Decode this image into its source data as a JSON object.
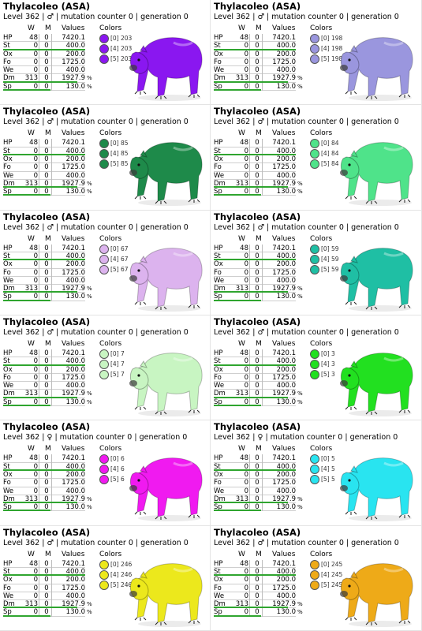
{
  "stat_headers": {
    "w": "W",
    "m": "M",
    "values": "Values",
    "colors": "Colors"
  },
  "cards": [
    {
      "title": "Thylacoleo (ASA)",
      "info": "Level 362 | ♂ | mutation counter 0 | generation 0",
      "accent": "#8a17f0",
      "stats": [
        {
          "label": "HP",
          "w": "48",
          "m": "0",
          "value": "7420.1",
          "unit": ""
        },
        {
          "label": "St",
          "w": "0",
          "m": "0",
          "value": "400.0",
          "unit": ""
        },
        {
          "label": "Ox",
          "w": "0",
          "m": "0",
          "value": "200.0",
          "unit": ""
        },
        {
          "label": "Fo",
          "w": "0",
          "m": "0",
          "value": "1725.0",
          "unit": ""
        },
        {
          "label": "We",
          "w": "0",
          "m": "0",
          "value": "400.0",
          "unit": ""
        },
        {
          "label": "Dm",
          "w": "313",
          "m": "0",
          "value": "1927.9",
          "unit": "%"
        },
        {
          "label": "Sp",
          "w": "0",
          "m": "0",
          "value": "130.0",
          "unit": "%"
        }
      ],
      "colors": [
        {
          "label": "[0] 203",
          "hex": "#8a17f0"
        },
        {
          "label": "[4] 203",
          "hex": "#8a17f0"
        },
        {
          "label": "[5] 203",
          "hex": "#8a17f0"
        }
      ]
    },
    {
      "title": "Thylacoleo (ASA)",
      "info": "Level 362 | ♂ | mutation counter 0 | generation 0",
      "accent": "#9a96de",
      "stats": [
        {
          "label": "HP",
          "w": "48",
          "m": "0",
          "value": "7420.1",
          "unit": ""
        },
        {
          "label": "St",
          "w": "0",
          "m": "0",
          "value": "400.0",
          "unit": ""
        },
        {
          "label": "Ox",
          "w": "0",
          "m": "0",
          "value": "200.0",
          "unit": ""
        },
        {
          "label": "Fo",
          "w": "0",
          "m": "0",
          "value": "1725.0",
          "unit": ""
        },
        {
          "label": "We",
          "w": "0",
          "m": "0",
          "value": "400.0",
          "unit": ""
        },
        {
          "label": "Dm",
          "w": "313",
          "m": "0",
          "value": "1927.9",
          "unit": "%"
        },
        {
          "label": "Sp",
          "w": "0",
          "m": "0",
          "value": "130.0",
          "unit": "%"
        }
      ],
      "colors": [
        {
          "label": "[0] 198",
          "hex": "#9a96de"
        },
        {
          "label": "[4] 198",
          "hex": "#9a96de"
        },
        {
          "label": "[5] 198",
          "hex": "#9a96de"
        }
      ]
    },
    {
      "title": "Thylacoleo (ASA)",
      "info": "Level 362 | ♂ | mutation counter 0 | generation 0",
      "accent": "#1e8a4a",
      "stats": [
        {
          "label": "HP",
          "w": "48",
          "m": "0",
          "value": "7420.1",
          "unit": ""
        },
        {
          "label": "St",
          "w": "0",
          "m": "0",
          "value": "400.0",
          "unit": ""
        },
        {
          "label": "Ox",
          "w": "0",
          "m": "0",
          "value": "200.0",
          "unit": ""
        },
        {
          "label": "Fo",
          "w": "0",
          "m": "0",
          "value": "1725.0",
          "unit": ""
        },
        {
          "label": "We",
          "w": "0",
          "m": "0",
          "value": "400.0",
          "unit": ""
        },
        {
          "label": "Dm",
          "w": "313",
          "m": "0",
          "value": "1927.9",
          "unit": "%"
        },
        {
          "label": "Sp",
          "w": "0",
          "m": "0",
          "value": "130.0",
          "unit": "%"
        }
      ],
      "colors": [
        {
          "label": "[0] 85",
          "hex": "#1e8a4a"
        },
        {
          "label": "[4] 85",
          "hex": "#1e8a4a"
        },
        {
          "label": "[5] 85",
          "hex": "#1e8a4a"
        }
      ]
    },
    {
      "title": "Thylacoleo (ASA)",
      "info": "Level 362 | ♂ | mutation counter 0 | generation 0",
      "accent": "#4fe38a",
      "stats": [
        {
          "label": "HP",
          "w": "48",
          "m": "0",
          "value": "7420.1",
          "unit": ""
        },
        {
          "label": "St",
          "w": "0",
          "m": "0",
          "value": "400.0",
          "unit": ""
        },
        {
          "label": "Ox",
          "w": "0",
          "m": "0",
          "value": "200.0",
          "unit": ""
        },
        {
          "label": "Fo",
          "w": "0",
          "m": "0",
          "value": "1725.0",
          "unit": ""
        },
        {
          "label": "We",
          "w": "0",
          "m": "0",
          "value": "400.0",
          "unit": ""
        },
        {
          "label": "Dm",
          "w": "313",
          "m": "0",
          "value": "1927.9",
          "unit": "%"
        },
        {
          "label": "Sp",
          "w": "0",
          "m": "0",
          "value": "130.0",
          "unit": "%"
        }
      ],
      "colors": [
        {
          "label": "[0] 84",
          "hex": "#4fe38a"
        },
        {
          "label": "[4] 84",
          "hex": "#4fe38a"
        },
        {
          "label": "[5] 84",
          "hex": "#4fe38a"
        }
      ]
    },
    {
      "title": "Thylacoleo (ASA)",
      "info": "Level 362 | ♂ | mutation counter 0 | generation 0",
      "accent": "#dcb3ee",
      "stats": [
        {
          "label": "HP",
          "w": "48",
          "m": "0",
          "value": "7420.1",
          "unit": ""
        },
        {
          "label": "St",
          "w": "0",
          "m": "0",
          "value": "400.0",
          "unit": ""
        },
        {
          "label": "Ox",
          "w": "0",
          "m": "0",
          "value": "200.0",
          "unit": ""
        },
        {
          "label": "Fo",
          "w": "0",
          "m": "0",
          "value": "1725.0",
          "unit": ""
        },
        {
          "label": "We",
          "w": "0",
          "m": "0",
          "value": "400.0",
          "unit": ""
        },
        {
          "label": "Dm",
          "w": "313",
          "m": "0",
          "value": "1927.9",
          "unit": "%"
        },
        {
          "label": "Sp",
          "w": "0",
          "m": "0",
          "value": "130.0",
          "unit": "%"
        }
      ],
      "colors": [
        {
          "label": "[0] 67",
          "hex": "#dcb3ee"
        },
        {
          "label": "[4] 67",
          "hex": "#dcb3ee"
        },
        {
          "label": "[5] 67",
          "hex": "#dcb3ee"
        }
      ]
    },
    {
      "title": "Thylacoleo (ASA)",
      "info": "Level 362 | ♂ | mutation counter 0 | generation 0",
      "accent": "#1fbfa4",
      "stats": [
        {
          "label": "HP",
          "w": "48",
          "m": "0",
          "value": "7420.1",
          "unit": ""
        },
        {
          "label": "St",
          "w": "0",
          "m": "0",
          "value": "400.0",
          "unit": ""
        },
        {
          "label": "Ox",
          "w": "0",
          "m": "0",
          "value": "200.0",
          "unit": ""
        },
        {
          "label": "Fo",
          "w": "0",
          "m": "0",
          "value": "1725.0",
          "unit": ""
        },
        {
          "label": "We",
          "w": "0",
          "m": "0",
          "value": "400.0",
          "unit": ""
        },
        {
          "label": "Dm",
          "w": "313",
          "m": "0",
          "value": "1927.9",
          "unit": "%"
        },
        {
          "label": "Sp",
          "w": "0",
          "m": "0",
          "value": "130.0",
          "unit": "%"
        }
      ],
      "colors": [
        {
          "label": "[0] 59",
          "hex": "#1fbfa4"
        },
        {
          "label": "[4] 59",
          "hex": "#1fbfa4"
        },
        {
          "label": "[5] 59",
          "hex": "#1fbfa4"
        }
      ]
    },
    {
      "title": "Thylacoleo (ASA)",
      "info": "Level 362 | ♂ | mutation counter 0 | generation 0",
      "accent": "#c8f5c2",
      "stats": [
        {
          "label": "HP",
          "w": "48",
          "m": "0",
          "value": "7420.1",
          "unit": ""
        },
        {
          "label": "St",
          "w": "0",
          "m": "0",
          "value": "400.0",
          "unit": ""
        },
        {
          "label": "Ox",
          "w": "0",
          "m": "0",
          "value": "200.0",
          "unit": ""
        },
        {
          "label": "Fo",
          "w": "0",
          "m": "0",
          "value": "1725.0",
          "unit": ""
        },
        {
          "label": "We",
          "w": "0",
          "m": "0",
          "value": "400.0",
          "unit": ""
        },
        {
          "label": "Dm",
          "w": "313",
          "m": "0",
          "value": "1927.9",
          "unit": "%"
        },
        {
          "label": "Sp",
          "w": "0",
          "m": "0",
          "value": "130.0",
          "unit": "%"
        }
      ],
      "colors": [
        {
          "label": "[0] 7",
          "hex": "#c8f5c2"
        },
        {
          "label": "[4] 7",
          "hex": "#c8f5c2"
        },
        {
          "label": "[5] 7",
          "hex": "#c8f5c2"
        }
      ]
    },
    {
      "title": "Thylacoleo (ASA)",
      "info": "Level 362 | ♂ | mutation counter 0 | generation 0",
      "accent": "#22e020",
      "stats": [
        {
          "label": "HP",
          "w": "48",
          "m": "0",
          "value": "7420.1",
          "unit": ""
        },
        {
          "label": "St",
          "w": "0",
          "m": "0",
          "value": "400.0",
          "unit": ""
        },
        {
          "label": "Ox",
          "w": "0",
          "m": "0",
          "value": "200.0",
          "unit": ""
        },
        {
          "label": "Fo",
          "w": "0",
          "m": "0",
          "value": "1725.0",
          "unit": ""
        },
        {
          "label": "We",
          "w": "0",
          "m": "0",
          "value": "400.0",
          "unit": ""
        },
        {
          "label": "Dm",
          "w": "313",
          "m": "0",
          "value": "1927.9",
          "unit": "%"
        },
        {
          "label": "Sp",
          "w": "0",
          "m": "0",
          "value": "130.0",
          "unit": "%"
        }
      ],
      "colors": [
        {
          "label": "[0] 3",
          "hex": "#22e020"
        },
        {
          "label": "[4] 3",
          "hex": "#22e020"
        },
        {
          "label": "[5] 3",
          "hex": "#22e020"
        }
      ]
    },
    {
      "title": "Thylacoleo (ASA)",
      "info": "Level 362 | ♀ | mutation counter 0 | generation 0",
      "accent": "#f01af0",
      "stats": [
        {
          "label": "HP",
          "w": "48",
          "m": "0",
          "value": "7420.1",
          "unit": ""
        },
        {
          "label": "St",
          "w": "0",
          "m": "0",
          "value": "400.0",
          "unit": ""
        },
        {
          "label": "Ox",
          "w": "0",
          "m": "0",
          "value": "200.0",
          "unit": ""
        },
        {
          "label": "Fo",
          "w": "0",
          "m": "0",
          "value": "1725.0",
          "unit": ""
        },
        {
          "label": "We",
          "w": "0",
          "m": "0",
          "value": "400.0",
          "unit": ""
        },
        {
          "label": "Dm",
          "w": "313",
          "m": "0",
          "value": "1927.9",
          "unit": "%"
        },
        {
          "label": "Sp",
          "w": "0",
          "m": "0",
          "value": "130.0",
          "unit": "%"
        }
      ],
      "colors": [
        {
          "label": "[0] 6",
          "hex": "#f01af0"
        },
        {
          "label": "[4] 6",
          "hex": "#f01af0"
        },
        {
          "label": "[5] 6",
          "hex": "#f01af0"
        }
      ]
    },
    {
      "title": "Thylacoleo (ASA)",
      "info": "Level 362 | ♀ | mutation counter 0 | generation 0",
      "accent": "#29e4f0",
      "stats": [
        {
          "label": "HP",
          "w": "48",
          "m": "0",
          "value": "7420.1",
          "unit": ""
        },
        {
          "label": "St",
          "w": "0",
          "m": "0",
          "value": "400.0",
          "unit": ""
        },
        {
          "label": "Ox",
          "w": "0",
          "m": "0",
          "value": "200.0",
          "unit": ""
        },
        {
          "label": "Fo",
          "w": "0",
          "m": "0",
          "value": "1725.0",
          "unit": ""
        },
        {
          "label": "We",
          "w": "0",
          "m": "0",
          "value": "400.0",
          "unit": ""
        },
        {
          "label": "Dm",
          "w": "313",
          "m": "0",
          "value": "1927.9",
          "unit": "%"
        },
        {
          "label": "Sp",
          "w": "0",
          "m": "0",
          "value": "130.0",
          "unit": "%"
        }
      ],
      "colors": [
        {
          "label": "[0] 5",
          "hex": "#29e4f0"
        },
        {
          "label": "[4] 5",
          "hex": "#29e4f0"
        },
        {
          "label": "[5] 5",
          "hex": "#29e4f0"
        }
      ]
    },
    {
      "title": "Thylacoleo (ASA)",
      "info": "Level 362 | ♂ | mutation counter 0 | generation 0",
      "accent": "#ece81c",
      "stats": [
        {
          "label": "HP",
          "w": "48",
          "m": "0",
          "value": "7420.1",
          "unit": ""
        },
        {
          "label": "St",
          "w": "0",
          "m": "0",
          "value": "400.0",
          "unit": ""
        },
        {
          "label": "Ox",
          "w": "0",
          "m": "0",
          "value": "200.0",
          "unit": ""
        },
        {
          "label": "Fo",
          "w": "0",
          "m": "0",
          "value": "1725.0",
          "unit": ""
        },
        {
          "label": "We",
          "w": "0",
          "m": "0",
          "value": "400.0",
          "unit": ""
        },
        {
          "label": "Dm",
          "w": "313",
          "m": "0",
          "value": "1927.9",
          "unit": "%"
        },
        {
          "label": "Sp",
          "w": "0",
          "m": "0",
          "value": "130.0",
          "unit": "%"
        }
      ],
      "colors": [
        {
          "label": "[0] 246",
          "hex": "#ece81c"
        },
        {
          "label": "[4] 246",
          "hex": "#ece81c"
        },
        {
          "label": "[5] 246",
          "hex": "#ece81c"
        }
      ]
    },
    {
      "title": "Thylacoleo (ASA)",
      "info": "Level 362 | ♂ | mutation counter 0 | generation 0",
      "accent": "#eeaa18",
      "stats": [
        {
          "label": "HP",
          "w": "48",
          "m": "0",
          "value": "7420.1",
          "unit": ""
        },
        {
          "label": "St",
          "w": "0",
          "m": "0",
          "value": "400.0",
          "unit": ""
        },
        {
          "label": "Ox",
          "w": "0",
          "m": "0",
          "value": "200.0",
          "unit": ""
        },
        {
          "label": "Fo",
          "w": "0",
          "m": "0",
          "value": "1725.0",
          "unit": ""
        },
        {
          "label": "We",
          "w": "0",
          "m": "0",
          "value": "400.0",
          "unit": ""
        },
        {
          "label": "Dm",
          "w": "313",
          "m": "0",
          "value": "1927.9",
          "unit": "%"
        },
        {
          "label": "Sp",
          "w": "0",
          "m": "0",
          "value": "130.0",
          "unit": "%"
        }
      ],
      "colors": [
        {
          "label": "[0] 245",
          "hex": "#eeaa18"
        },
        {
          "label": "[4] 245",
          "hex": "#eeaa18"
        },
        {
          "label": "[5] 245",
          "hex": "#eeaa18"
        }
      ]
    }
  ]
}
